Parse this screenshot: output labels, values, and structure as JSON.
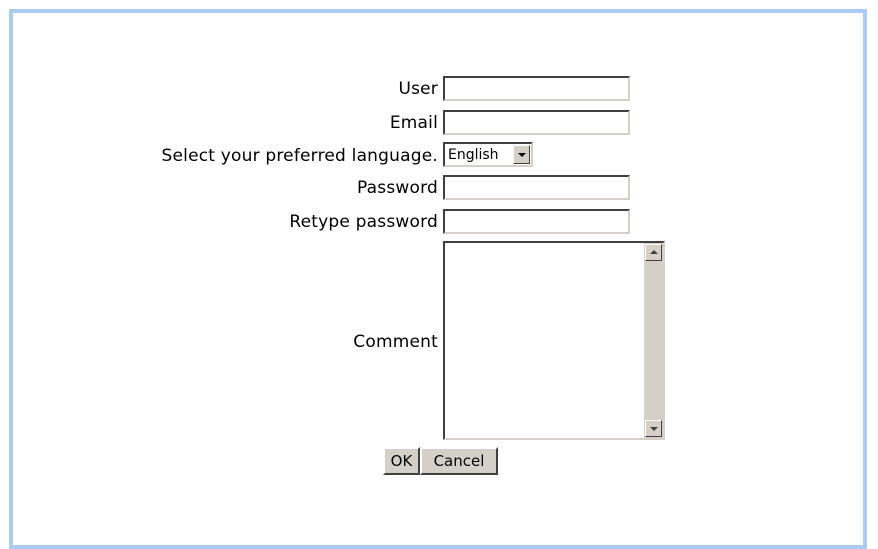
{
  "form": {
    "user_label": "User",
    "email_label": "Email",
    "language_label": "Select your preferred language.",
    "language_selected": "English",
    "password_label": "Password",
    "retype_label": "Retype password",
    "comment_label": "Comment",
    "ok_label": "OK",
    "cancel_label": "Cancel"
  },
  "colors": {
    "frame_border": "#aaccf2",
    "control_face": "#d4d0c8"
  },
  "icons": {
    "select_arrow": "chevron-down-icon",
    "scroll_up": "scroll-up-icon",
    "scroll_down": "scroll-down-icon"
  }
}
